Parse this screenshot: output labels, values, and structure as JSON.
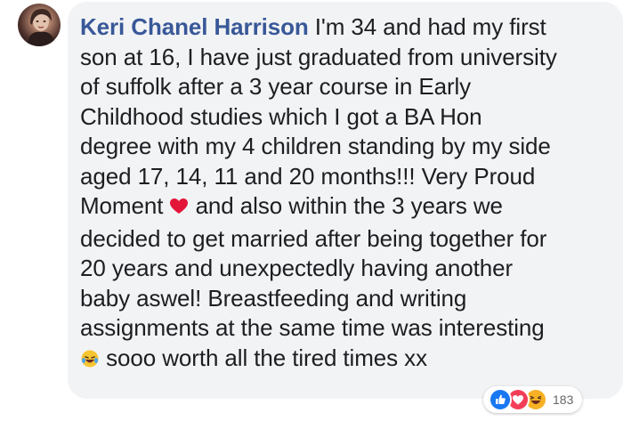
{
  "comment": {
    "author": "Keri Chanel Harrison",
    "lines": [
      " I'm 34 and had my first",
      "son at 16, I have just graduated from university",
      "of suffolk after a 3 year course in Early",
      "Childhood studies which I got a BA Hon",
      "degree with my 4 children standing by my side",
      "aged 17, 14, 11 and 20 months!!! Very Proud",
      "Moment ",
      " and also within the 3 years we",
      "decided to get married after being together for",
      "20 years and unexpectedly having another",
      "baby aswel! Breastfeeding and writing",
      "assignments at the same time was interesting",
      " sooo worth all the tired times xx"
    ],
    "inline_emojis": [
      "red-heart-emoji",
      "rofl-emoji"
    ]
  },
  "reactions": {
    "icons": [
      "like-reaction-icon",
      "love-reaction-icon",
      "haha-reaction-icon"
    ],
    "count": "183",
    "colors": {
      "like": "#1877f2",
      "love": "#f33e58",
      "haha": "#f7b125"
    }
  },
  "colors": {
    "author_name": "#385898",
    "bubble": "#f2f3f5",
    "text": "#1c1e21"
  }
}
